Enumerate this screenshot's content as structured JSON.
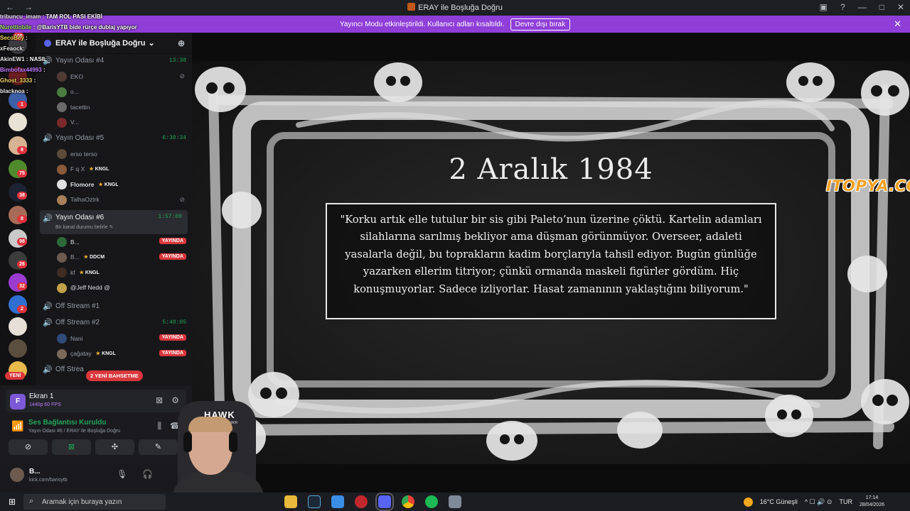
{
  "window": {
    "title": "ERAY ile Boşluğa Doğru",
    "back_icon": "←",
    "forward_icon": "→",
    "controls": [
      "▣",
      "?",
      "—",
      "□",
      "✕"
    ]
  },
  "notice": {
    "text": "Yayıncı Modu etkinleştirildi. Kullanıcı adları kısaltıldı.",
    "button": "Devre dışı bırak",
    "close": "✕",
    "color": "#8f3ed8"
  },
  "chat_overlay": [
    {
      "user": "tribuncu_imam",
      "msg": ": TAM ROL PASI EKİBİ"
    },
    {
      "user": "Nurettinbile",
      "msg": ": @BarisYTB bide rürçe dublaj yapıyor"
    },
    {
      "user": "SecoBey",
      "msg": ":"
    },
    {
      "user": "xFeaock:",
      "msg": ""
    },
    {
      "user": "AkinEW1",
      "msg": ": NASIL"
    },
    {
      "user": "Bimbofax44993",
      "msg": ":"
    },
    {
      "user": "Ghost_3333",
      "msg": ":"
    },
    {
      "user": "blacknoa",
      "msg": ":"
    }
  ],
  "server_badges": [
    "105",
    "1",
    "8",
    "75",
    "38",
    "8",
    "98",
    "26",
    "32",
    "2"
  ],
  "channels": {
    "guild_name": "ERAY ile Boşluğa Doğru",
    "guild_chevron": "⌄",
    "invite_icon": "⊕",
    "rooms": [
      {
        "name": "Yayın Odası #4",
        "timer": "13:38",
        "members": [
          {
            "name": "EKO",
            "mic_off": true
          },
          {
            "name": "o..."
          },
          {
            "name": "tacettin"
          },
          {
            "name": "V..."
          }
        ]
      },
      {
        "name": "Yayın Odası #5",
        "timer": "6:30:34",
        "members": [
          {
            "name": "erso terso"
          },
          {
            "name": "F q X",
            "tag": "KNGL"
          },
          {
            "name": "Flomore",
            "tag": "KNGL"
          },
          {
            "name": "TalhaOztrk",
            "mic_off": true
          }
        ]
      },
      {
        "name": "Yayın Odası #6",
        "timer": "1:57:00",
        "status": "Bir kanal durumu belirle ✎",
        "members": [
          {
            "name": "B...",
            "live": "YAYINDA"
          },
          {
            "name": "B...",
            "tag": "DDCM",
            "live": "YAYINDA"
          },
          {
            "name": "kf",
            "tag": "KNGL"
          },
          {
            "name": "@Jeff Nedd @"
          }
        ]
      },
      {
        "name": "Off Stream #1"
      },
      {
        "name": "Off Stream #2",
        "timer": "5:40:05",
        "members": [
          {
            "name": "Nani",
            "live": "YAYINDA"
          },
          {
            "name": "çağatay",
            "tag": "KNGL",
            "live": "YAYINDA"
          }
        ]
      },
      {
        "name": "Off Strea"
      }
    ],
    "new_label": "YENİ",
    "mention_pill": "2 YENİ BAHSETME"
  },
  "panel": {
    "screen_title": "Ekran 1",
    "screen_sub": "1440p 60 FPS",
    "voice_status": "Ses Bağlantısı Kuruldu",
    "voice_sub": "Yayın Odası #6 / ERAY ile Boşluğa Doğru",
    "ctrl_icons": [
      "⊘",
      "⊠",
      "✣",
      "✎"
    ],
    "user_name": "B...",
    "user_sub": "kick.com/barisytb"
  },
  "stage": {
    "date": "2 Aralık 1984",
    "quote": "\"Korku artık elle tutulur bir sis gibi Paleto’nun üzerine çöktü. Kartelin adamları silahlarına sarılmış bekliyor ama düşman görünmüyor. Overseer, adaleti yasalarla değil, bu toprakların kadim borçlarıyla tahsil ediyor. Bugün günlüğe yazarken ellerim titriyor; çünkü ormanda maskeli figürler gördüm. Hiç konuşmuyorlar. Sadece izliyorlar. Hasat zamanının yaklaştığını biliyorum.\"",
    "watermark": "ITOPYA.COM"
  },
  "webcam": {
    "chair_brand": "HAWK",
    "chair_sub": "GAMING CHAIR"
  },
  "taskbar": {
    "start_icon": "⊞",
    "search_placeholder": "Aramak için buraya yazın",
    "weather": "16°C  Güneşli",
    "lang": "TUR",
    "time": "17:14",
    "date": "28/04/2026",
    "tray_icons": "^  ☐  🔊  ⊙"
  }
}
